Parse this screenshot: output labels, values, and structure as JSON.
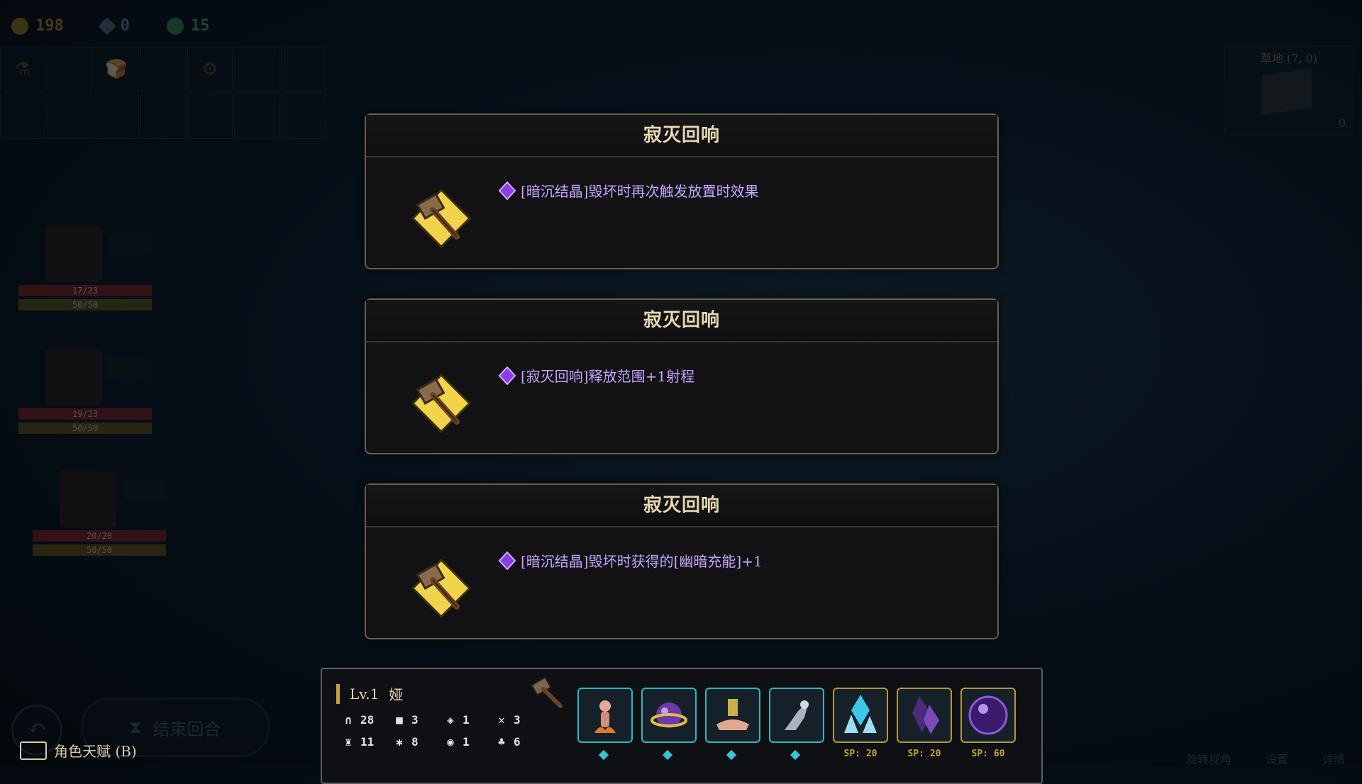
{
  "resources": [
    {
      "name": "gold",
      "value": "198"
    },
    {
      "name": "ore",
      "value": "0"
    },
    {
      "name": "leaf",
      "value": "15"
    }
  ],
  "minimap": {
    "label": "草地 (7, 0)",
    "count": "0"
  },
  "heroes": [
    {
      "hp": "17/23",
      "ap": "50/50"
    },
    {
      "hp": "19/23",
      "ap": "50/50"
    },
    {
      "hp": "20/20",
      "ap": "50/50"
    }
  ],
  "controls": {
    "end_turn": "结束回合",
    "talent": "角色天赋 (B)",
    "hints": [
      "旋转视角",
      "设置",
      "详情"
    ]
  },
  "cards": [
    {
      "title": "寂灭回响",
      "text": "[暗沉结晶]毁坏时再次触发放置时效果"
    },
    {
      "title": "寂灭回响",
      "text": "[寂灭回响]释放范围+1射程"
    },
    {
      "title": "寂灭回响",
      "text": "[暗沉结晶]毁坏时获得的[幽暗充能]+1"
    }
  ],
  "character": {
    "level": "Lv.1",
    "name": "娅",
    "stats": [
      "28",
      "3",
      "1",
      "3",
      "11",
      "8",
      "1",
      "6"
    ],
    "skills": [
      {
        "icon": "flame-figure-icon",
        "cost": ""
      },
      {
        "icon": "dark-orb-ring-icon",
        "cost": ""
      },
      {
        "icon": "crystal-hand-icon",
        "cost": ""
      },
      {
        "icon": "spirit-dash-icon",
        "cost": ""
      },
      {
        "icon": "ice-crystal-icon",
        "cost": "SP: 20"
      },
      {
        "icon": "dark-crystal-icon",
        "cost": "SP: 20"
      },
      {
        "icon": "void-sphere-icon",
        "cost": "SP: 60"
      }
    ]
  },
  "colors": {
    "accent_purple": "#c7a4ff",
    "card_border": "#6b5f45",
    "gold": "#c9a23c",
    "cyan": "#2fb6c4"
  }
}
